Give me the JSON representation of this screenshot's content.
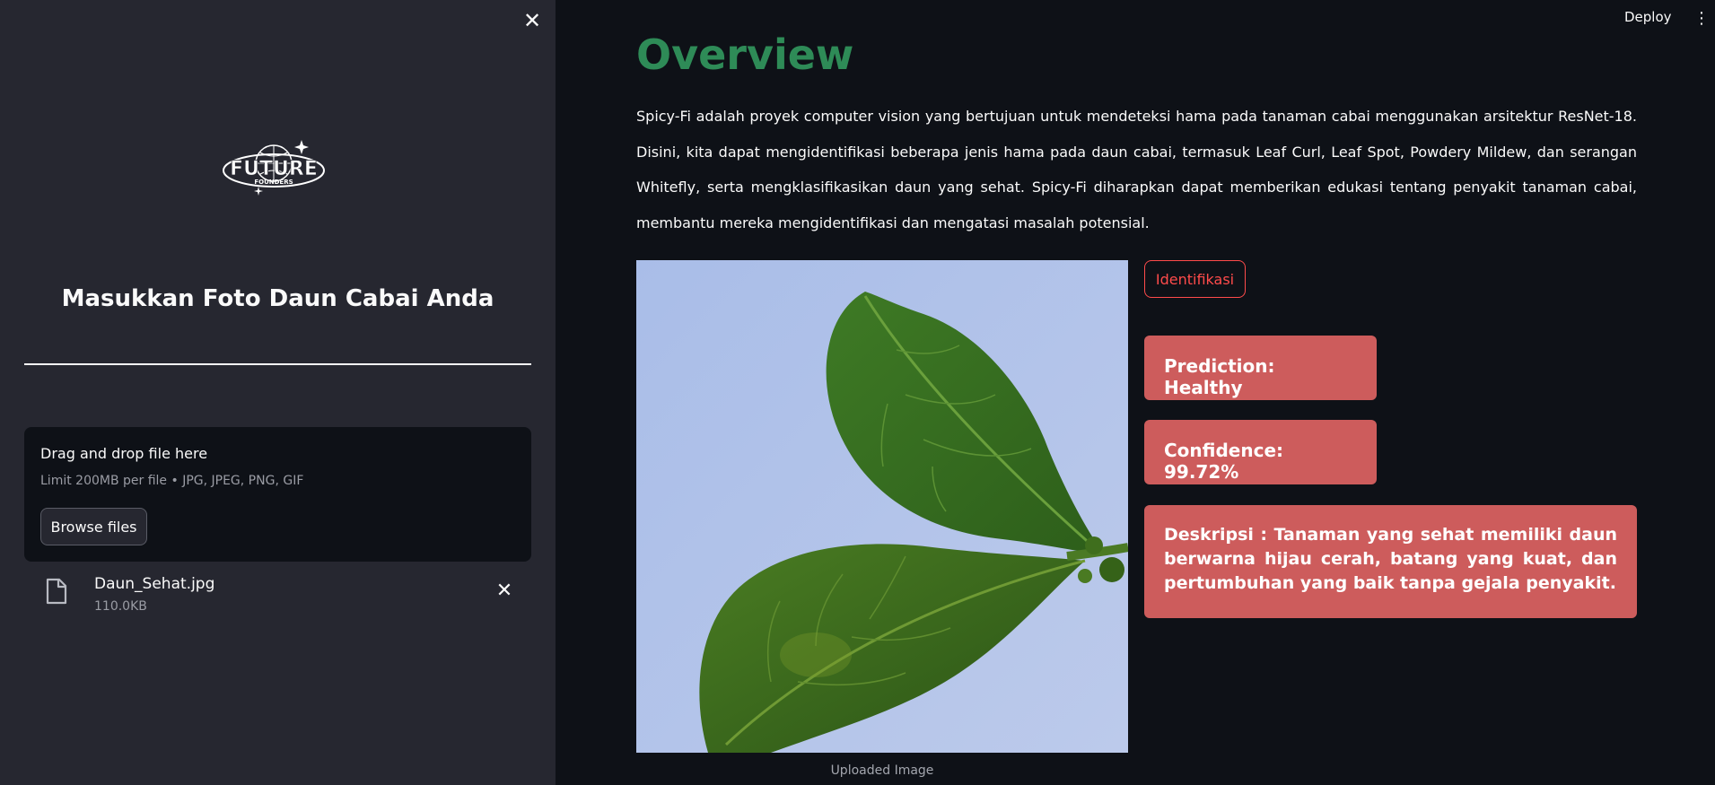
{
  "sidebar": {
    "logo_text": "FUTURE",
    "logo_subtext": "FOUNDERS",
    "title": "Masukkan Foto Daun Cabai Anda",
    "uploader": {
      "drag_text": "Drag and drop file here",
      "limit_text": "Limit 200MB per file • JPG, JPEG, PNG, GIF",
      "browse_label": "Browse files"
    },
    "file": {
      "name": "Daun_Sehat.jpg",
      "size": "110.0KB"
    }
  },
  "header": {
    "deploy_label": "Deploy"
  },
  "main": {
    "title": "Overview",
    "intro": "Spicy-Fi adalah proyek computer vision yang bertujuan untuk mendeteksi hama pada tanaman cabai menggunakan arsitektur ResNet-18. Disini, kita dapat mengidentifikasi beberapa jenis hama pada daun cabai, termasuk Leaf Curl, Leaf Spot, Powdery Mildew, dan serangan Whitefly, serta mengklasifikasikan daun yang sehat. Spicy-Fi diharapkan dapat memberikan edukasi tentang penyakit tanaman cabai, membantu mereka mengidentifikasi dan mengatasi masalah potensial.",
    "image_caption": "Uploaded Image",
    "identify_label": "Identifikasi",
    "prediction": "Prediction: Healthy",
    "confidence": "Confidence: 99.72%",
    "description": "Deskripsi : Tanaman yang sehat memiliki daun berwarna hijau cerah, batang yang kuat, dan pertumbuhan yang baik tanpa gejala penyakit."
  },
  "colors": {
    "title_green": "#2e8b57",
    "accent_red": "#ff4b4b",
    "result_box": "#cd5c5c",
    "sidebar_bg": "#262730",
    "main_bg": "#0e1117"
  }
}
